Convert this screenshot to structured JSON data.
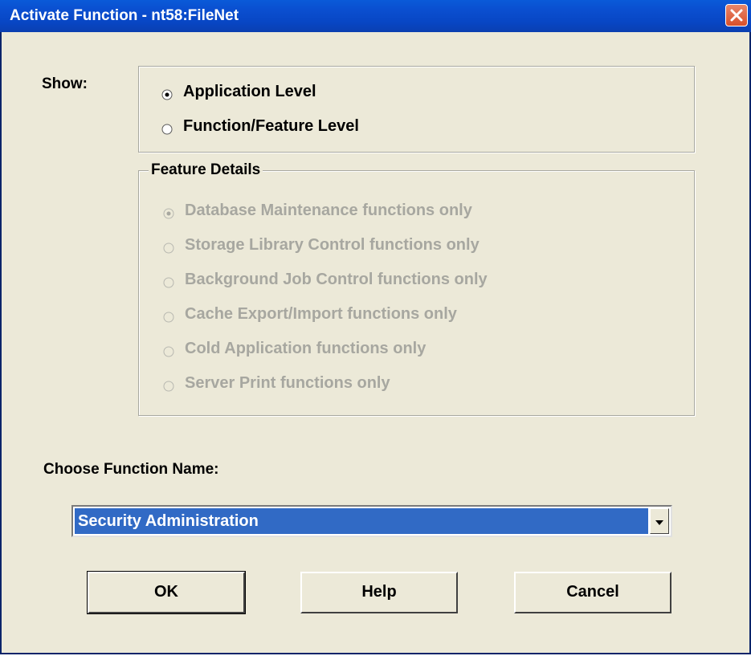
{
  "window": {
    "title": "Activate Function - nt58:FileNet"
  },
  "show": {
    "label": "Show:",
    "options": [
      {
        "label": "Application Level",
        "selected": true
      },
      {
        "label": "Function/Feature Level",
        "selected": false
      }
    ]
  },
  "feature_details": {
    "legend": "Feature Details",
    "enabled": false,
    "options": [
      {
        "label": "Database Maintenance functions only",
        "selected": true
      },
      {
        "label": "Storage Library Control functions only",
        "selected": false
      },
      {
        "label": "Background Job Control functions only",
        "selected": false
      },
      {
        "label": "Cache Export/Import functions only",
        "selected": false
      },
      {
        "label": "Cold Application functions only",
        "selected": false
      },
      {
        "label": "Server Print functions only",
        "selected": false
      }
    ]
  },
  "function_name": {
    "label": "Choose Function Name:",
    "value": "Security Administration"
  },
  "buttons": {
    "ok": "OK",
    "help": "Help",
    "cancel": "Cancel"
  },
  "colors": {
    "titlebar": "#0a4fd0",
    "selection": "#316ac5",
    "dialog_bg": "#ece9d8",
    "disabled_text": "#a7a7a0"
  }
}
